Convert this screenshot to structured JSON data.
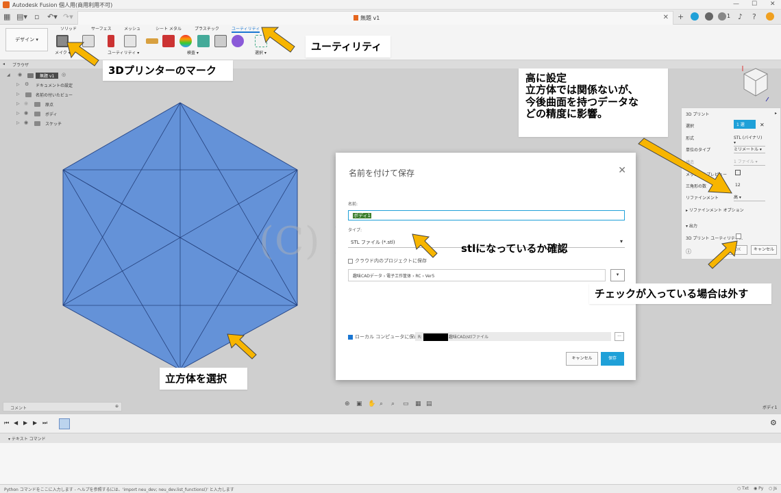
{
  "app": {
    "title": "Autodesk Fusion 個人用(商用利用不可)",
    "doc_title": "無題 v1",
    "online_count": "1",
    "job_count": "1"
  },
  "toolbar": {
    "workspace": "デザイン ▾",
    "tabs": [
      "ソリッド",
      "サーフェス",
      "メッシュ",
      "シート メタル",
      "プラスチック",
      "ユーティリティ"
    ],
    "groups": {
      "make": "メイク ▾",
      "utility": "ユーティリティ ▾",
      "inspect": "検査 ▾",
      "select": "選択 ▾"
    }
  },
  "browser": {
    "header": "ブラウザ",
    "items": [
      {
        "label": "無題 v1"
      },
      {
        "label": "ドキュメントの設定"
      },
      {
        "label": "名前の付いたビュー"
      },
      {
        "label": "原点"
      },
      {
        "label": "ボディ"
      },
      {
        "label": "スケッチ"
      }
    ]
  },
  "dialog": {
    "title": "名前を付けて保存",
    "name_label": "名前:",
    "name_value": "ボディ1",
    "type_label": "タイプ:",
    "type_value": "STL ファイル (*.stl)",
    "cloud_checkbox": "クラウド内のプロジェクトに保存",
    "cloud_path": [
      "趣味CADデータ",
      "電子工作筐体",
      "RC",
      "Ver5"
    ],
    "local_checkbox": "ローカル コンピュータに保存",
    "local_path_prefix": "R:",
    "local_path_suffix": "趣味CAD/stlファイル",
    "browse": "...",
    "cancel": "キャンセル",
    "save": "保存"
  },
  "print_panel": {
    "title": "3D プリント",
    "rows": [
      {
        "label": "選択",
        "value": "1 選"
      },
      {
        "label": "形式",
        "value": "STL (バイナリ) ▾"
      },
      {
        "label": "単位のタイプ",
        "value": "ミリメートル ▾"
      },
      {
        "label": "構造",
        "value": "1 ファイル ▾"
      },
      {
        "label": "メッシュをプレビュー",
        "value": ""
      },
      {
        "label": "三角形の数",
        "value": "12"
      },
      {
        "label": "リファインメント",
        "value": "高 ▾"
      }
    ],
    "refinement_options": "リファインメント オプション",
    "output_header": "出力",
    "output_checkbox": "3D プリント ユーティリティ...",
    "ok": "OK",
    "cancel": "キャンセル"
  },
  "bottom": {
    "comment": "コメント",
    "body_label": "ボディ1",
    "text_command": "テキスト コマンド",
    "status": "Python コマンドをここに入力します - ヘルプを参照するには、'import neu_dev; neu_dev.list_functions()' と入力します",
    "lang_txt": "Txt",
    "lang_py": "Py",
    "lang_js": "Js"
  },
  "annotations": {
    "utility": "ユーティリティ",
    "printer_mark": "3Dプリンターのマーク",
    "refinement_note": [
      "高に設定",
      "立方体では関係ないが、",
      "今後曲面を持つデータな",
      "どの精度に影響。"
    ],
    "stl_check": "stlになっているか確認",
    "uncheck": "チェックが入っている場合は外す",
    "select_cube": "立方体を選択",
    "watermark": "(C) Rcat999"
  },
  "colors": {
    "cube_face": "#6492d8",
    "accent": "#1fa0d8",
    "arrow": "#f7b500",
    "utility_tab": "#1976d2"
  }
}
